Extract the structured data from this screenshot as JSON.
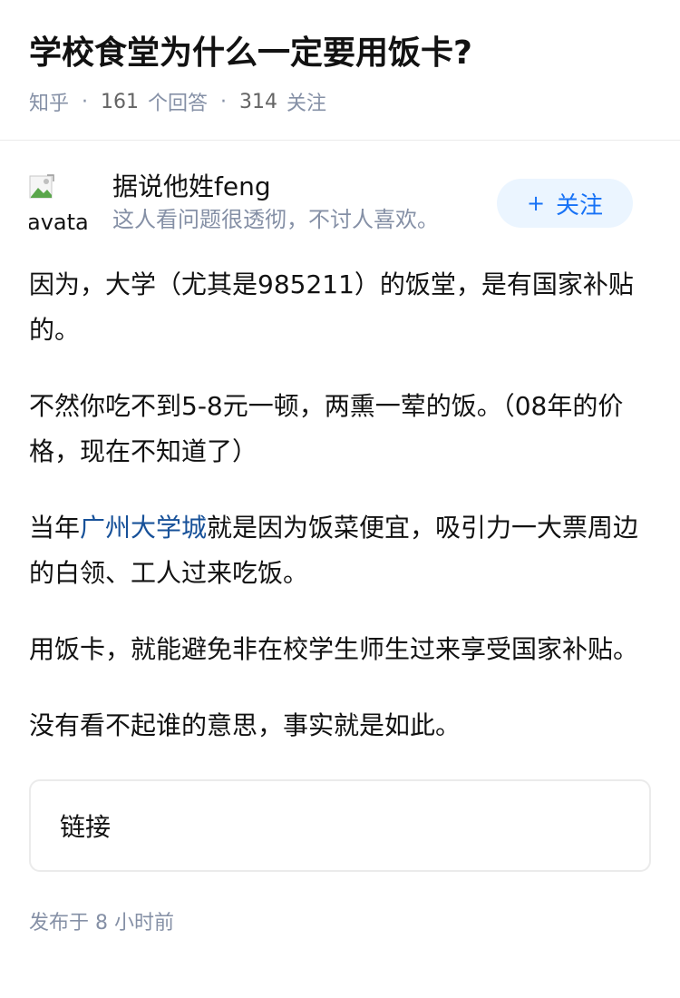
{
  "question": {
    "title": "学校食堂为什么一定要用饭卡?",
    "source": "知乎",
    "answers_count": "161",
    "answers_label": "个回答",
    "followers_count": "314",
    "followers_label": "关注"
  },
  "author": {
    "avatar_alt": "avatar",
    "name": "据说他姓feng",
    "bio": "这人看问题很透彻，不讨人喜欢。",
    "follow_plus": "+",
    "follow_label": "关注"
  },
  "answer": {
    "p1": "因为，大学（尤其是985211）的饭堂，是有国家补贴的。",
    "p2": "不然你吃不到5-8元一顿，两熏一荤的饭。（08年的价格，现在不知道了）",
    "p3_before": "当年",
    "p3_link": "广州大学城",
    "p3_after": "就是因为饭菜便宜，吸引力一大票周边的白领、工人过来吃饭。",
    "p4": "用饭卡，就能避免非在校学生师生过来享受国家补贴。",
    "p5": "没有看不起谁的意思，事实就是如此。"
  },
  "link_card": {
    "label": "链接"
  },
  "footer": {
    "published": "发布于  8 小时前"
  },
  "colors": {
    "accent": "#1772f6",
    "link": "#175199",
    "muted": "#8590a6",
    "follow_bg": "#ebf5ff"
  }
}
